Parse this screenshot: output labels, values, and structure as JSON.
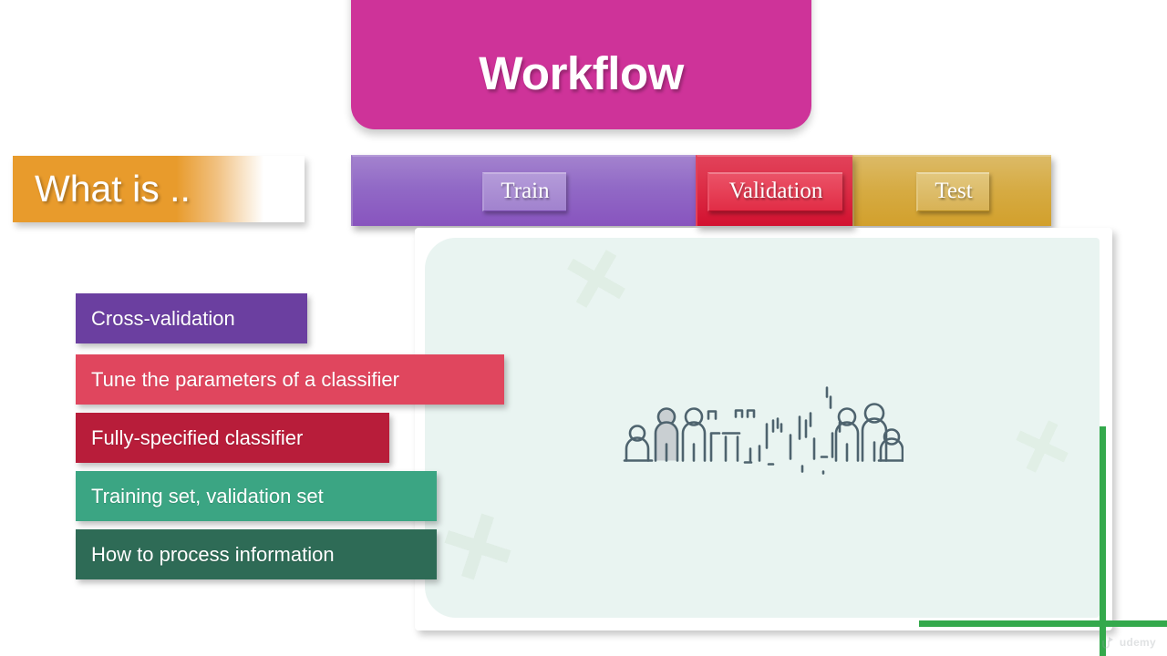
{
  "slide": {
    "title": "Workflow",
    "section_label": "What is .."
  },
  "workflow_stages": [
    {
      "id": "train",
      "label": "Train",
      "color": "#8854BE"
    },
    {
      "id": "validation",
      "label": "Validation",
      "color": "#D21130"
    },
    {
      "id": "test",
      "label": "Test",
      "color": "#D2A02C"
    }
  ],
  "keywords": [
    {
      "label": "Cross-validation",
      "color": "#6B3FA0"
    },
    {
      "label": "Tune the parameters of a classifier",
      "color": "#E0465E"
    },
    {
      "label": "Fully-specified classifier",
      "color": "#B81D3A"
    },
    {
      "label": "Training set, validation set",
      "color": "#3BA583"
    },
    {
      "label": "How to process information",
      "color": "#2E6B56"
    }
  ],
  "content_card": {
    "illustration_name": "people-crowd-dispersing-icon",
    "background_color": "#E9F4F1"
  },
  "accents": {
    "green_line_color": "#34A94C",
    "title_banner_color": "#CE3399",
    "section_bar_color": "#E89B2C"
  },
  "watermark": {
    "text": "udemy"
  }
}
